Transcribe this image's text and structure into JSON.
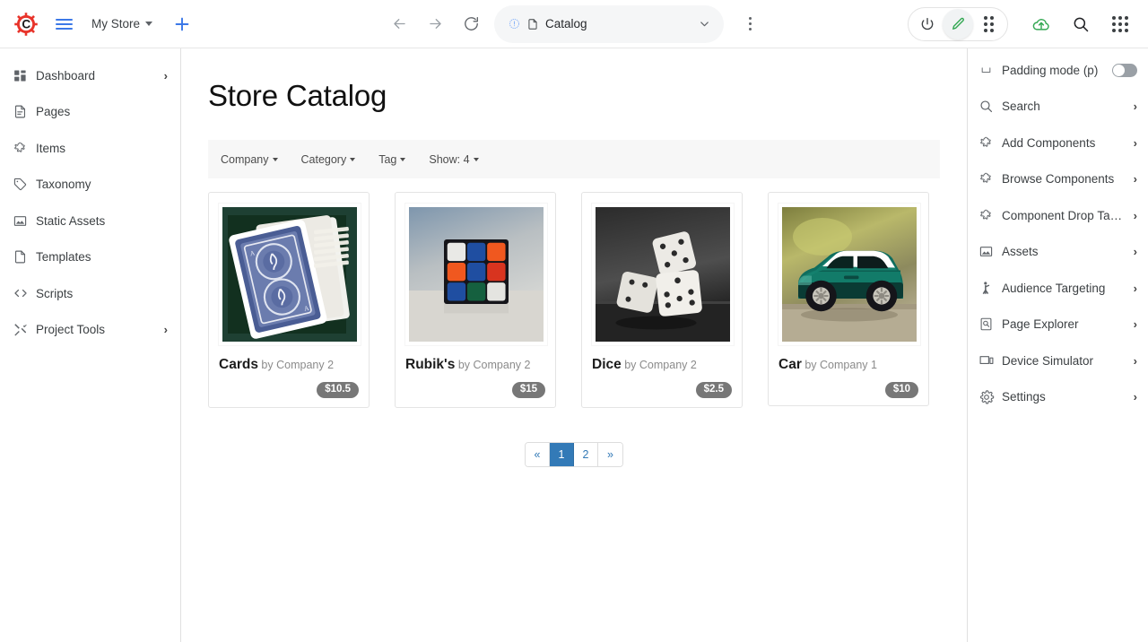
{
  "topbar": {
    "logo_icon": "gear-c-logo",
    "menu_icon": "hamburger-icon",
    "store_name": "My Store",
    "add_icon": "plus-icon",
    "back_icon": "arrow-left-icon",
    "forward_icon": "arrow-right-icon",
    "reload_icon": "reload-icon",
    "url_status_icon": "info-circle-icon",
    "url_doc_icon": "document-icon",
    "url_value": "Catalog",
    "url_dropdown_icon": "chevron-down-icon",
    "more_icon": "kebab-menu-icon",
    "right_icons": [
      {
        "name": "power-icon",
        "label": "Power"
      },
      {
        "name": "edit-pencil-icon",
        "label": "Edit",
        "active": true,
        "color": "#34a853"
      },
      {
        "name": "grid-dots-icon",
        "label": "Apps"
      }
    ],
    "cloud_icon": "cloud-upload-icon",
    "cloud_color": "#34a853",
    "search_icon": "search-icon",
    "apps_icon": "app-grid-icon"
  },
  "sidebar": {
    "items": [
      {
        "label": "Dashboard",
        "icon": "dashboard-icon",
        "chevron": true
      },
      {
        "label": "Pages",
        "icon": "pages-icon",
        "chevron": false
      },
      {
        "label": "Items",
        "icon": "puzzle-piece-icon",
        "chevron": false
      },
      {
        "label": "Taxonomy",
        "icon": "tag-icon",
        "chevron": false
      },
      {
        "label": "Static Assets",
        "icon": "image-icon",
        "chevron": false
      },
      {
        "label": "Templates",
        "icon": "file-icon",
        "chevron": false
      },
      {
        "label": "Scripts",
        "icon": "code-brackets-icon",
        "chevron": false
      },
      {
        "label": "Project Tools",
        "icon": "tools-icon",
        "chevron": true
      }
    ]
  },
  "main": {
    "title": "Store Catalog",
    "filters": [
      {
        "label": "Company",
        "caret": true
      },
      {
        "label": "Category",
        "caret": true
      },
      {
        "label": "Tag",
        "caret": true
      },
      {
        "label": "Show: 4",
        "caret": true
      }
    ],
    "products": [
      {
        "name": "Cards",
        "by": "by Company 2",
        "price": "$10.5",
        "image": "playing-cards-photo"
      },
      {
        "name": "Rubik's",
        "by": "by Company 2",
        "price": "$15",
        "image": "rubiks-cube-photo"
      },
      {
        "name": "Dice",
        "by": "by Company 2",
        "price": "$2.5",
        "image": "dice-photo"
      },
      {
        "name": "Car",
        "by": "by Company 1",
        "price": "$10",
        "image": "toy-car-photo"
      }
    ],
    "pagination": {
      "prev_label": "«",
      "next_label": "»",
      "pages": [
        "1",
        "2"
      ],
      "active_page": "1",
      "active_color": "#337ab7"
    }
  },
  "rightpanel": {
    "padding_mode": {
      "label": "Padding mode (p)",
      "icon": "padding-icon",
      "enabled": false
    },
    "items": [
      {
        "label": "Search",
        "icon": "search-icon",
        "chevron": true
      },
      {
        "label": "Add Components",
        "icon": "puzzle-piece-icon",
        "chevron": true
      },
      {
        "label": "Browse Components",
        "icon": "puzzle-piece-icon",
        "chevron": true
      },
      {
        "label": "Component Drop Ta…",
        "icon": "puzzle-piece-icon",
        "chevron": true
      },
      {
        "label": "Assets",
        "icon": "image-icon",
        "chevron": true
      },
      {
        "label": "Audience Targeting",
        "icon": "person-icon",
        "chevron": true
      },
      {
        "label": "Page Explorer",
        "icon": "page-search-icon",
        "chevron": true
      },
      {
        "label": "Device Simulator",
        "icon": "devices-icon",
        "chevron": true
      },
      {
        "label": "Settings",
        "icon": "gear-icon",
        "chevron": true
      }
    ]
  }
}
